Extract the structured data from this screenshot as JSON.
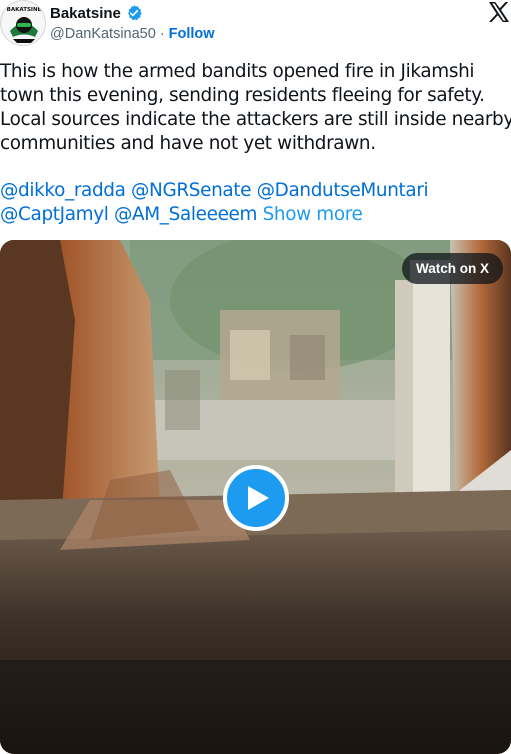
{
  "author": {
    "display_name": "Bakatsine",
    "handle": "@DanKatsina50",
    "separator": "·",
    "follow_label": "Follow",
    "avatar_text": "BAKATSINE",
    "verified": true
  },
  "icons": {
    "verified": "verified-badge-icon",
    "platform": "x-logo-icon",
    "play": "play-icon"
  },
  "tweet": {
    "lines": [
      "This is how the armed bandits opened fire in Jikamshi",
      "town this evening, sending residents fleeing for safety.",
      "Local sources indicate the attackers are still inside nearby",
      "communities and have not yet withdrawn."
    ],
    "mentions_line1": [
      "@dikko_radda",
      "@NGRSenate",
      "@DandutseMuntari"
    ],
    "mentions_line2": [
      "@CaptJamyl",
      "@AM_Saleeeem"
    ],
    "show_more_label": "Show more"
  },
  "media": {
    "watch_label": "Watch on X"
  },
  "colors": {
    "link": "#006fd6",
    "show_more": "#1d9bf0",
    "verified": "#1d9bf0",
    "play": "#1d9bf0",
    "text": "#0f1419",
    "muted": "#536471"
  }
}
